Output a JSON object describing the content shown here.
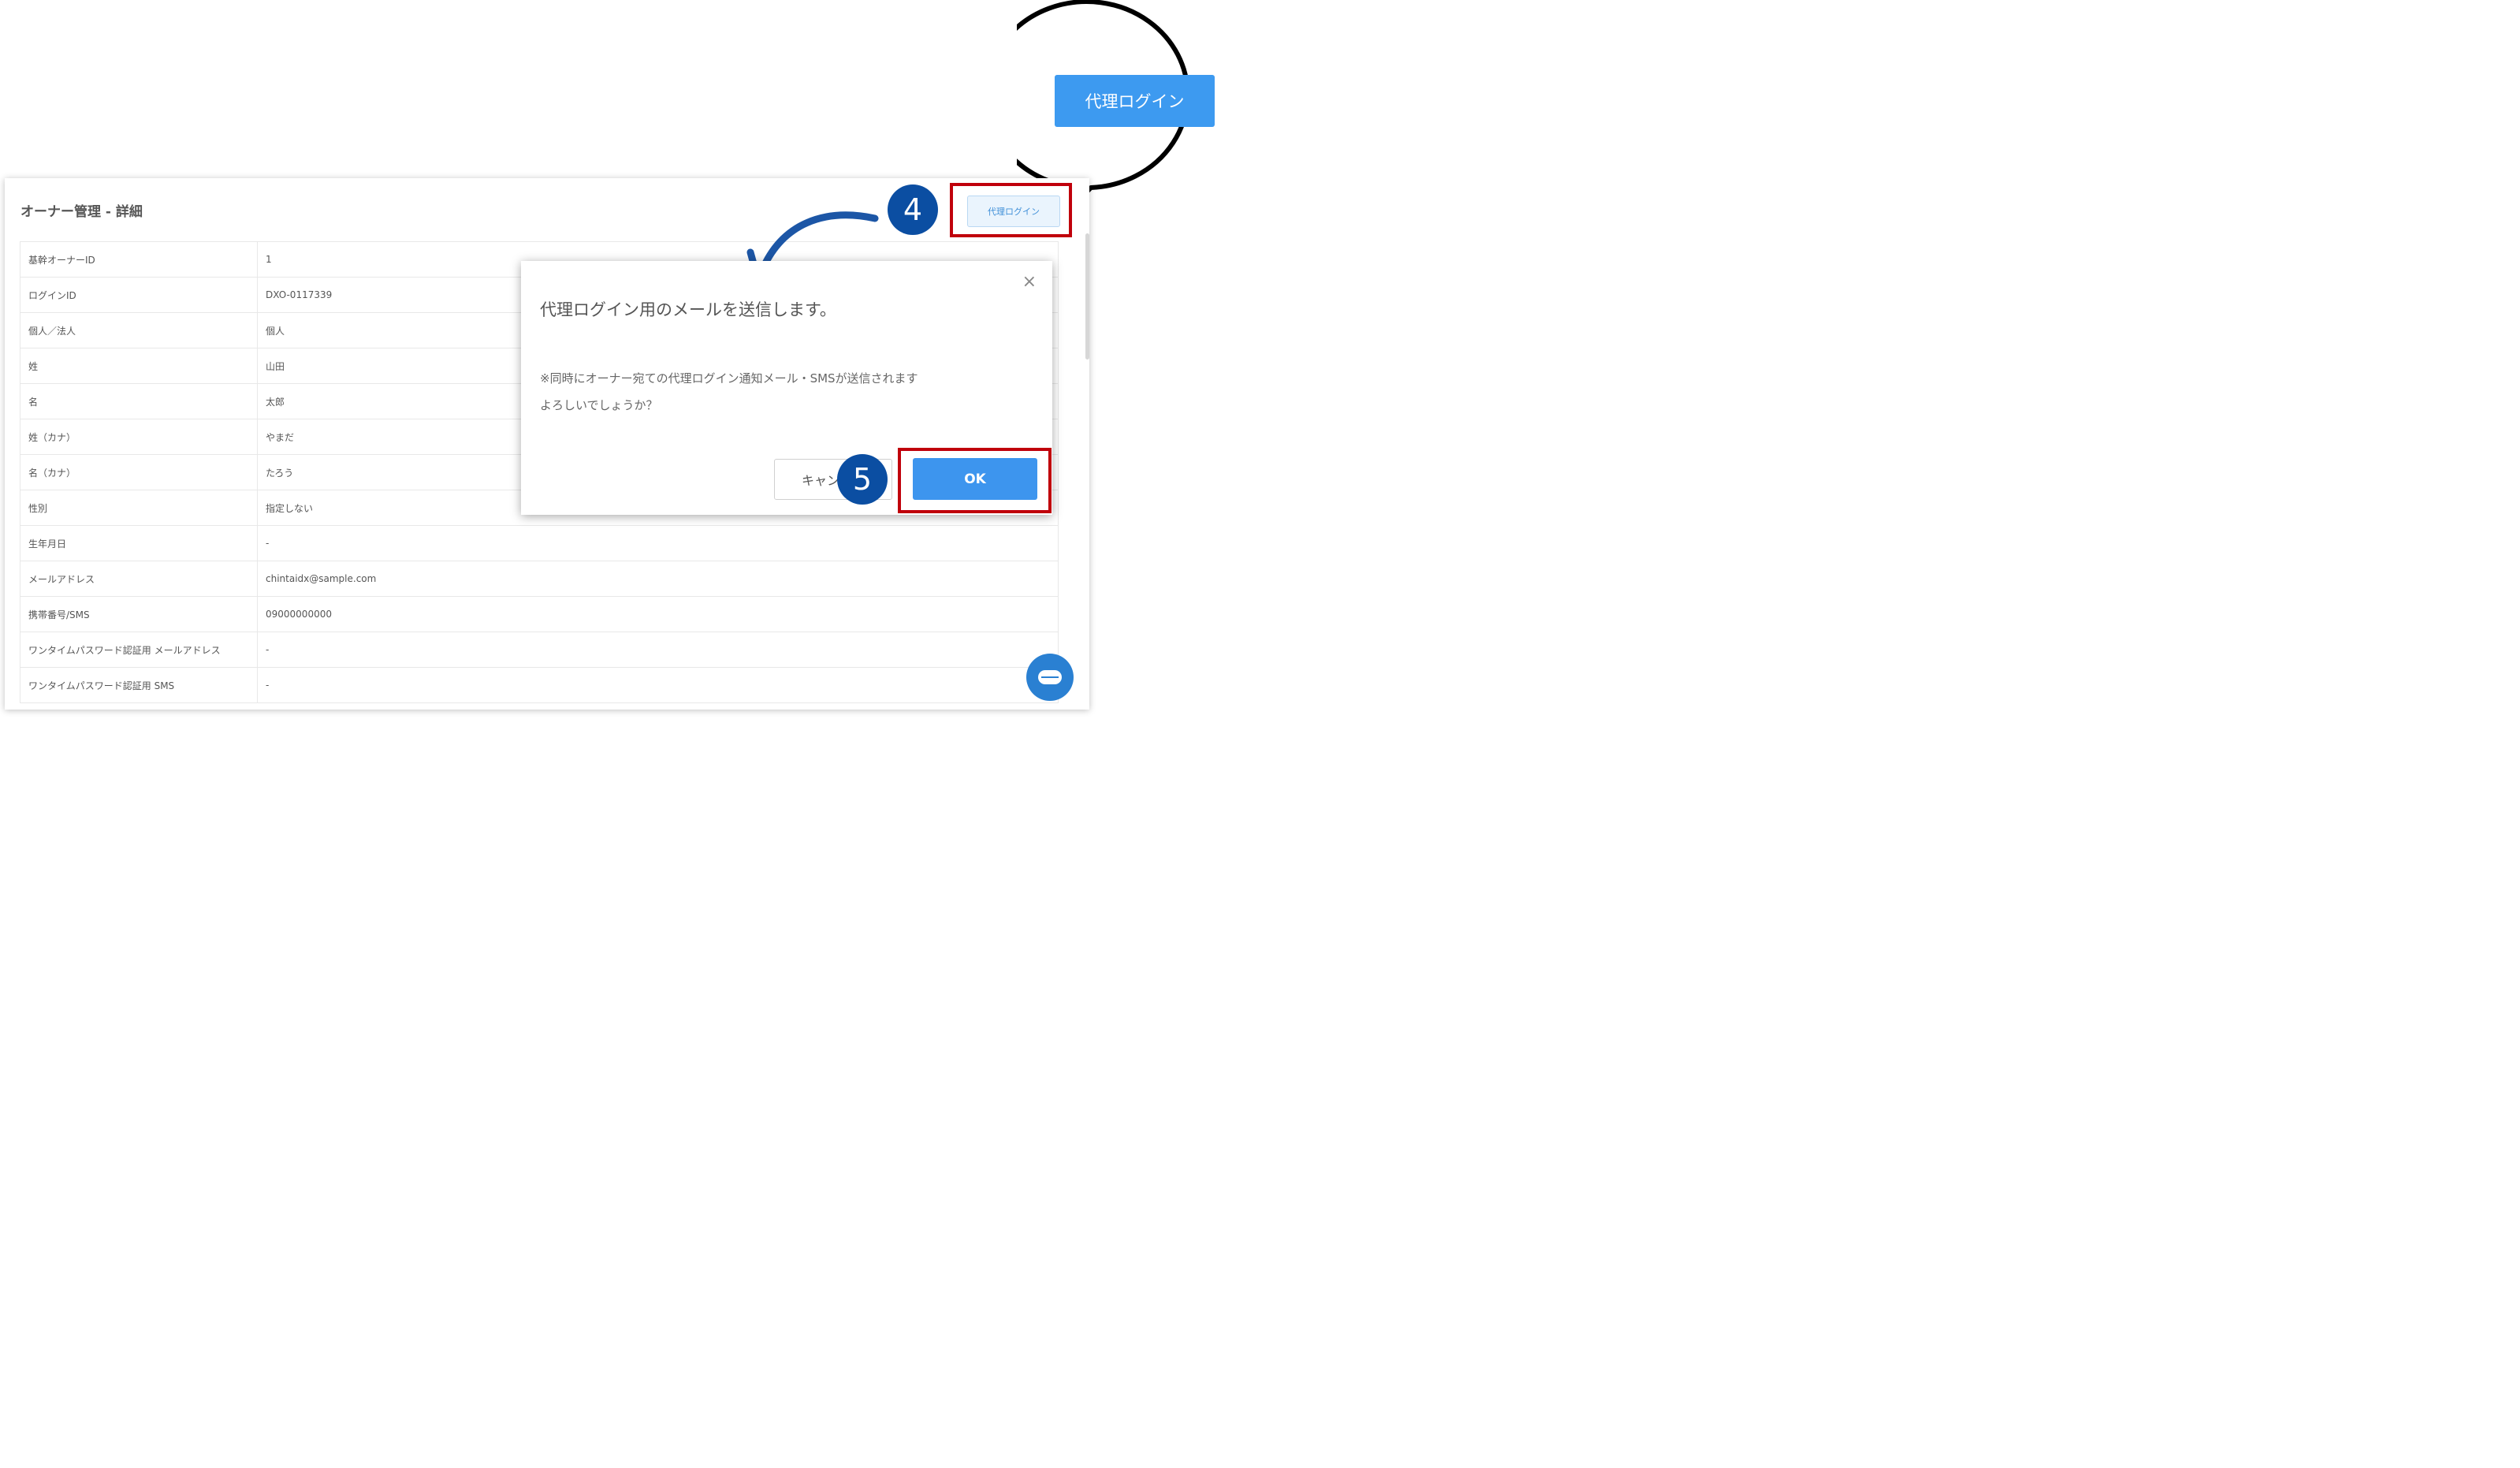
{
  "page": {
    "title": "オーナー管理 - 詳細",
    "proxy_login_label": "代理ログイン"
  },
  "details": [
    {
      "label": "基幹オーナーID",
      "value": "1"
    },
    {
      "label": "ログインID",
      "value": "DXO-0117339"
    },
    {
      "label": "個人／法人",
      "value": "個人"
    },
    {
      "label": "姓",
      "value": "山田"
    },
    {
      "label": "名",
      "value": "太郎"
    },
    {
      "label": "姓（カナ）",
      "value": "やまだ"
    },
    {
      "label": "名（カナ）",
      "value": "たろう"
    },
    {
      "label": "性別",
      "value": "指定しない"
    },
    {
      "label": "生年月日",
      "value": "-"
    },
    {
      "label": "メールアドレス",
      "value": "chintaidx@sample.com"
    },
    {
      "label": "携帯番号/SMS",
      "value": "09000000000"
    },
    {
      "label": "ワンタイムパスワード認証用 メールアドレス",
      "value": "-"
    },
    {
      "label": "ワンタイムパスワード認証用 SMS",
      "value": "-"
    }
  ],
  "dialog": {
    "title": "代理ログイン用のメールを送信します。",
    "message_line1": "※同時にオーナー宛ての代理ログイン通知メール・SMSが送信されます",
    "message_line2": "よろしいでしょうか？",
    "cancel_label": "キャンセル",
    "ok_label": "OK",
    "close_glyph": "×"
  },
  "annotations": {
    "step4": "4",
    "step5": "5",
    "callout_label": "代理ログイン"
  },
  "colors": {
    "primary": "#3d95ee",
    "highlight_border": "#c0000b",
    "step_badge": "#0b4ea2"
  },
  "icons": {
    "close": "close-icon",
    "chat": "chat-icon"
  }
}
